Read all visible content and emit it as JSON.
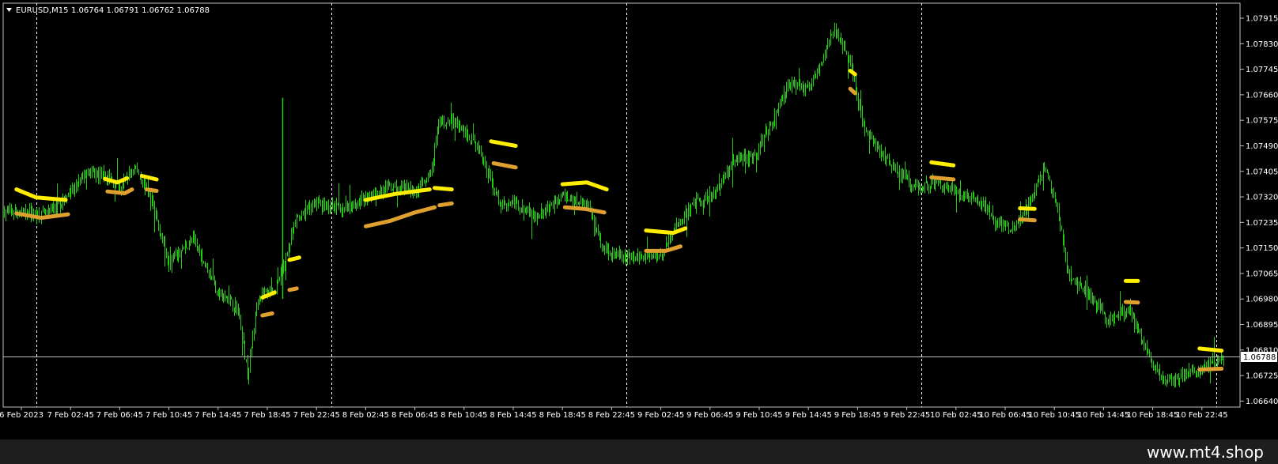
{
  "header": {
    "symbol_text": "EURUSD,M15",
    "quotes_text": "1.06764 1.06791 1.06762 1.06788"
  },
  "watermark": "www.mt4.shop",
  "colors": {
    "background": "#000000",
    "candle": "#22cc11",
    "resistance": "#ffee00",
    "support": "#e0a030",
    "grid": "#ffffff",
    "price_line": "#c0c0c0"
  },
  "chart_data": {
    "type": "candlestick",
    "symbol": "EURUSD",
    "timeframe": "M15",
    "open": 1.06764,
    "high": 1.06791,
    "low": 1.06762,
    "close": 1.06788,
    "current_price": 1.06788,
    "current_price_label": "1.06788",
    "ylim": [
      1.0662,
      1.07965
    ],
    "y_ticks": [
      "1.07915",
      "1.07830",
      "1.07745",
      "1.07660",
      "1.07575",
      "1.07490",
      "1.07405",
      "1.07320",
      "1.07235",
      "1.07150",
      "1.07065",
      "1.06980",
      "1.06895",
      "1.06810",
      "1.06725",
      "1.06640"
    ],
    "x_ticks": [
      "6 Feb 2023",
      "7 Feb 02:45",
      "7 Feb 06:45",
      "7 Feb 10:45",
      "7 Feb 14:45",
      "7 Feb 18:45",
      "7 Feb 22:45",
      "8 Feb 02:45",
      "8 Feb 06:45",
      "8 Feb 10:45",
      "8 Feb 14:45",
      "8 Feb 18:45",
      "8 Feb 22:45",
      "9 Feb 02:45",
      "9 Feb 06:45",
      "9 Feb 10:45",
      "9 Feb 14:45",
      "9 Feb 18:45",
      "9 Feb 22:45",
      "10 Feb 02:45",
      "10 Feb 06:45",
      "10 Feb 10:45",
      "10 Feb 14:45",
      "10 Feb 18:45",
      "10 Feb 22:45"
    ],
    "day_separators_at_tick": [
      0.3,
      6.3,
      12.3,
      18.3,
      24.3
    ],
    "close_path": [
      [
        0,
        1.0727
      ],
      [
        0.5,
        1.0726
      ],
      [
        1,
        1.0733
      ],
      [
        1.3,
        1.074
      ],
      [
        1.7,
        1.0739
      ],
      [
        2.0,
        1.0735
      ],
      [
        2.3,
        1.0742
      ],
      [
        2.6,
        1.0733
      ],
      [
        3,
        1.071
      ],
      [
        3.5,
        1.0718
      ],
      [
        4,
        1.07
      ],
      [
        4.4,
        1.0695
      ],
      [
        4.6,
        1.0672
      ],
      [
        4.8,
        1.0699
      ],
      [
        5.2,
        1.0702
      ],
      [
        5.6,
        1.0725
      ],
      [
        6,
        1.073
      ],
      [
        6.5,
        1.0728
      ],
      [
        7,
        1.0732
      ],
      [
        7.5,
        1.0735
      ],
      [
        8,
        1.0734
      ],
      [
        8.3,
        1.0738
      ],
      [
        8.5,
        1.0757
      ],
      [
        8.9,
        1.0756
      ],
      [
        9.3,
        1.0748
      ],
      [
        9.7,
        1.073
      ],
      [
        10,
        1.073
      ],
      [
        10.5,
        1.0725
      ],
      [
        11,
        1.0732
      ],
      [
        11.5,
        1.073
      ],
      [
        11.8,
        1.0715
      ],
      [
        12.2,
        1.0712
      ],
      [
        12.6,
        1.0712
      ],
      [
        13.0,
        1.0713
      ],
      [
        13.3,
        1.0722
      ],
      [
        13.7,
        1.073
      ],
      [
        14.1,
        1.0733
      ],
      [
        14.5,
        1.0745
      ],
      [
        14.9,
        1.0745
      ],
      [
        15.2,
        1.0755
      ],
      [
        15.6,
        1.077
      ],
      [
        16.0,
        1.0768
      ],
      [
        16.3,
        1.0778
      ],
      [
        16.5,
        1.0788
      ],
      [
        16.8,
        1.078
      ],
      [
        17.1,
        1.0756
      ],
      [
        17.4,
        1.0748
      ],
      [
        17.8,
        1.074
      ],
      [
        18.2,
        1.0735
      ],
      [
        18.6,
        1.0737
      ],
      [
        19.0,
        1.0734
      ],
      [
        19.5,
        1.073
      ],
      [
        19.8,
        1.0723
      ],
      [
        20.2,
        1.0722
      ],
      [
        20.5,
        1.073
      ],
      [
        20.8,
        1.0742
      ],
      [
        21.1,
        1.0725
      ],
      [
        21.3,
        1.0705
      ],
      [
        21.7,
        1.07
      ],
      [
        22.1,
        1.069
      ],
      [
        22.5,
        1.0695
      ],
      [
        22.9,
        1.068
      ],
      [
        23.2,
        1.067
      ],
      [
        23.6,
        1.0673
      ],
      [
        24.0,
        1.0674
      ],
      [
        24.3,
        1.0678
      ],
      [
        24.45,
        1.06788
      ]
    ],
    "series": [
      {
        "name": "resistance",
        "color": "#ffee00",
        "segments": [
          [
            [
              -0.1,
              1.07345
            ],
            [
              0.3,
              1.07318
            ],
            [
              0.9,
              1.0731
            ]
          ],
          [
            [
              1.7,
              1.0738
            ],
            [
              1.95,
              1.07368
            ],
            [
              2.15,
              1.07382
            ]
          ],
          [
            [
              2.45,
              1.0739
            ],
            [
              2.75,
              1.07378
            ]
          ],
          [
            [
              4.9,
              1.06985
            ],
            [
              5.15,
              1.07002
            ]
          ],
          [
            [
              5.45,
              1.0711
            ],
            [
              5.65,
              1.07118
            ]
          ],
          [
            [
              7.0,
              1.0731
            ],
            [
              7.6,
              1.0733
            ],
            [
              8.3,
              1.07345
            ]
          ],
          [
            [
              8.4,
              1.0735
            ],
            [
              8.75,
              1.07345
            ]
          ],
          [
            [
              9.55,
              1.07505
            ],
            [
              10.05,
              1.0749
            ]
          ],
          [
            [
              11.0,
              1.07362
            ],
            [
              11.5,
              1.07368
            ],
            [
              11.9,
              1.07345
            ]
          ],
          [
            [
              12.7,
              1.07208
            ],
            [
              13.25,
              1.072
            ],
            [
              13.5,
              1.07215
            ]
          ],
          [
            [
              16.85,
              1.0774
            ],
            [
              16.95,
              1.07728
            ]
          ],
          [
            [
              18.5,
              1.07435
            ],
            [
              18.95,
              1.07425
            ]
          ],
          [
            [
              20.3,
              1.07282
            ],
            [
              20.6,
              1.0728
            ]
          ],
          [
            [
              22.45,
              1.0704
            ],
            [
              22.7,
              1.0704
            ]
          ],
          [
            [
              23.95,
              1.06815
            ],
            [
              24.4,
              1.06808
            ]
          ]
        ]
      },
      {
        "name": "support",
        "color": "#e0a030",
        "segments": [
          [
            [
              -0.1,
              1.07265
            ],
            [
              0.4,
              1.0725
            ],
            [
              0.95,
              1.07262
            ]
          ],
          [
            [
              1.75,
              1.07338
            ],
            [
              2.1,
              1.07332
            ],
            [
              2.25,
              1.07345
            ]
          ],
          [
            [
              2.55,
              1.07345
            ],
            [
              2.75,
              1.0734
            ]
          ],
          [
            [
              4.9,
              1.06925
            ],
            [
              5.1,
              1.06932
            ]
          ],
          [
            [
              5.45,
              1.0701
            ],
            [
              5.6,
              1.07015
            ]
          ],
          [
            [
              7.0,
              1.07222
            ],
            [
              7.5,
              1.0724
            ],
            [
              8.0,
              1.07268
            ],
            [
              8.4,
              1.07285
            ]
          ],
          [
            [
              8.5,
              1.07292
            ],
            [
              8.75,
              1.07298
            ]
          ],
          [
            [
              9.6,
              1.07432
            ],
            [
              10.05,
              1.07418
            ]
          ],
          [
            [
              11.05,
              1.07285
            ],
            [
              11.45,
              1.0728
            ],
            [
              11.85,
              1.07268
            ]
          ],
          [
            [
              12.7,
              1.0714
            ],
            [
              13.1,
              1.0714
            ],
            [
              13.4,
              1.07155
            ]
          ],
          [
            [
              16.85,
              1.0768
            ],
            [
              16.95,
              1.07665
            ]
          ],
          [
            [
              18.5,
              1.07385
            ],
            [
              18.95,
              1.07378
            ]
          ],
          [
            [
              20.3,
              1.07245
            ],
            [
              20.6,
              1.07242
            ]
          ],
          [
            [
              22.45,
              1.0697
            ],
            [
              22.7,
              1.06968
            ]
          ],
          [
            [
              23.95,
              1.06745
            ],
            [
              24.4,
              1.06748
            ]
          ]
        ]
      }
    ]
  }
}
